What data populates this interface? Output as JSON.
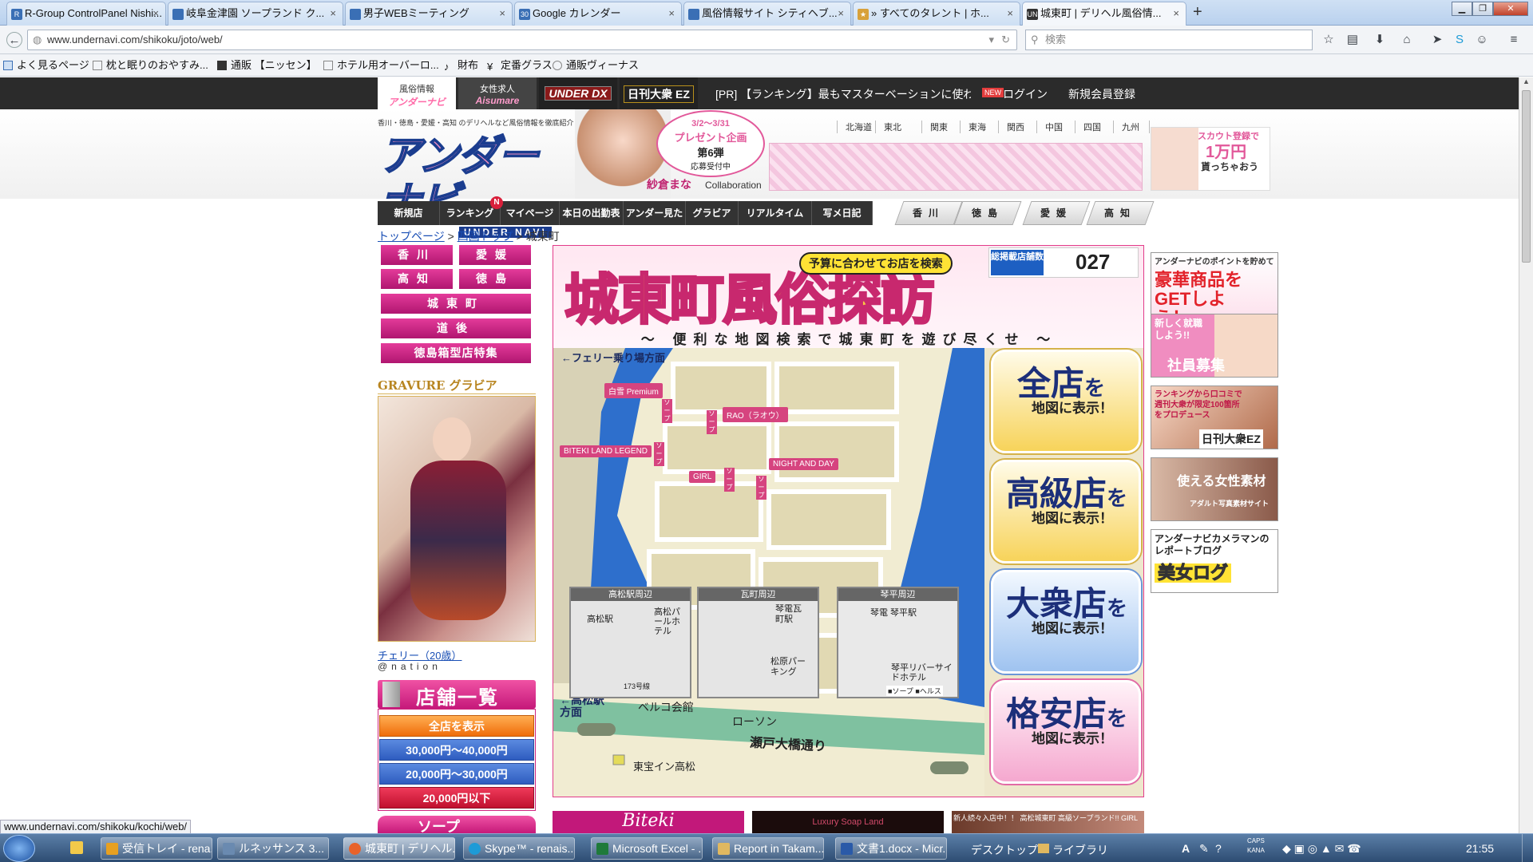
{
  "browser": {
    "tabs": [
      {
        "label": "R-Group ControlPanel Nishi...",
        "favicon": "page-icon"
      },
      {
        "label": "岐阜金津園 ソープランド ク...",
        "favicon": "page-icon"
      },
      {
        "label": "男子WEBミーティング",
        "favicon": "page-icon"
      },
      {
        "label": "Google カレンダー",
        "favicon": "calendar-icon"
      },
      {
        "label": "風俗情報サイト シティヘブ...",
        "favicon": "page-icon"
      },
      {
        "label": "» すべてのタレント | ホ...",
        "favicon": "star-icon"
      },
      {
        "label": "城東町 | デリヘル風俗情...",
        "favicon": "un-icon"
      }
    ],
    "new_tab": "+",
    "url": "www.undernavi.com/shikoku/joto/web/",
    "search_placeholder": "検索",
    "bookmarks": [
      "よく見るページ",
      "枕と眠りのおやすみ...",
      "通販 【ニッセン】",
      "ホテル用オーバーロ...",
      "財布",
      "定番グラス",
      "通販ヴィーナス"
    ],
    "status_url": "www.undernavi.com/shikoku/kochi/web/"
  },
  "site": {
    "topbar": {
      "tabs": [
        {
          "top": "風俗情報",
          "logo": "アンダーナビ"
        },
        {
          "top": "女性求人",
          "logo": "Aisumare"
        },
        {
          "top": "",
          "logo": "UNDER DX"
        },
        {
          "top": "",
          "logo": "日刊大衆 EZ"
        }
      ],
      "pr_text": "[PR] 【ランキング】最もマスターベーションに使わ...",
      "new_badge": "NEW",
      "login": "ログイン",
      "register": "新規会員登録"
    },
    "tagline": "香川・徳島・愛媛・高知 のデリヘルなど風俗情報を徹底紹介",
    "logo": "アンダーナビ",
    "logo_sub": "UNDER NAVI",
    "promo": {
      "dates": "3/2〜3/31",
      "title": "プレゼント企画",
      "round": "第6弾",
      "status": "応募受付中",
      "name": "紗倉まな",
      "collab": "Collaboration"
    },
    "regions": [
      "北海道",
      "東北",
      "関東",
      "東海",
      "関西",
      "中国",
      "四国",
      "九州"
    ],
    "scout": {
      "line1": "スカウト登録で",
      "line2": "1万円",
      "line3": "貰っちゃおう"
    },
    "menu": [
      "新規店",
      "ランキング",
      "マイページ",
      "本日の出勤表",
      "アンダー見た",
      "グラビア",
      "リアルタイム",
      "写メ日記"
    ],
    "menu_badge": "N",
    "prefs": [
      "香川",
      "徳島",
      "愛媛",
      "高知"
    ],
    "breadcrumb": {
      "top": "トップページ",
      "shikoku": "四国トップ",
      "sep": ">",
      "current": "城東町"
    },
    "left_nav": {
      "row1": [
        "香川",
        "愛媛"
      ],
      "row2": [
        "高知",
        "徳島"
      ],
      "joto": "城東町",
      "dogo": "道後",
      "box": "徳島箱型店特集"
    },
    "gravure": {
      "title": "GRAVURE グラビア",
      "caption": "チェリー（20歳）",
      "credit": "@nation"
    },
    "store_list": {
      "title": "店舗一覧",
      "all": "全店を表示",
      "prices": [
        "30,000円〜40,000円",
        "20,000円〜30,000円",
        "20,000円以下"
      ],
      "next": "ソープ"
    },
    "map": {
      "title": "城東町風俗探訪",
      "search_badge": "予算に合わせてお店を検索",
      "count_label": "総掲載店舗数",
      "count": "027",
      "subtitle": "〜 便利な地図検索で城東町を遊び尽くせ 〜",
      "ferry": "←フェリー乗り場方面",
      "shops": [
        "白雪 Premium",
        "RAO（ラオウ）",
        "BITEKI LAND LEGEND",
        "NIGHT AND DAY",
        "GIRL"
      ],
      "soap_tag": "ソープ",
      "buttons": [
        {
          "main": "全店",
          "suffix": "を",
          "sub": "地図に表示！"
        },
        {
          "main": "高級店",
          "suffix": "を",
          "sub": "地図に表示！"
        },
        {
          "main": "大衆店",
          "suffix": "を",
          "sub": "地図に表示！"
        },
        {
          "main": "格安店",
          "suffix": "を",
          "sub": "地図に表示！"
        }
      ],
      "insets": [
        {
          "title": "高松駅周辺",
          "a": "高松駅",
          "b": "高松パールホテル",
          "c": "173号線"
        },
        {
          "title": "瓦町周辺",
          "a": "琴電瓦町駅",
          "b": "松原パーキング",
          "c": ""
        },
        {
          "title": "琴平周辺",
          "a": "琴電 琴平駅",
          "b": "琴平リバーサイドホテル",
          "c": ""
        }
      ],
      "legend": {
        "soap": "ソープ",
        "health": "ヘルス"
      },
      "takamatsu": "←高松駅方面",
      "belco": "ベルコ会館",
      "lawson": "ローソン",
      "road": "瀬戸大橋通り",
      "toho": "東宝イン高松"
    },
    "right_banners": [
      {
        "text": "アンダーナビのポイントを貯めて",
        "big": "豪華商品をGETしよう！"
      },
      {
        "text": "新しく就職しよう!!",
        "big": "社員募集"
      },
      {
        "text": "ランキングから口コミで週刊大衆が限定100箇所をプロデュース",
        "big": "日刊大衆EZ"
      },
      {
        "text": "アダルト写真素材サイト",
        "big": "使える女性素材"
      },
      {
        "text": "アンダーナビカメラマンのレポートブログ",
        "big": "美女ログ"
      }
    ],
    "bottom_banners": [
      "Biteki",
      "Luxury Soap Land",
      "新人続々入店中！！ 高松城東町 高級ソープランド!! GIRL"
    ]
  },
  "taskbar": {
    "items": [
      "受信トレイ - rena...",
      "ルネッサンス 3...",
      "城東町 | デリヘル...",
      "Skype™ - renais...",
      "Microsoft Excel - ...",
      "Report in Takam...",
      "文書1.docx - Micr...",
      "デスクトップ",
      "ライブラリ"
    ],
    "time": "21:55",
    "caps": "CAPS",
    "kana": "KANA"
  }
}
